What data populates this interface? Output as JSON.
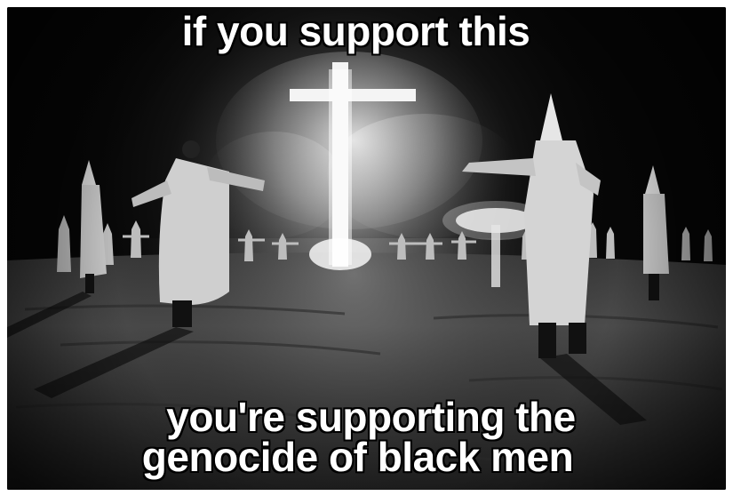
{
  "meme": {
    "top_text": "if you support this",
    "bottom_text_line1": "you're supporting the",
    "bottom_text_line2": "genocide of black men"
  },
  "colors": {
    "caption_fill": "#ffffff",
    "caption_outline": "#000000",
    "photo_background": "#050505"
  }
}
